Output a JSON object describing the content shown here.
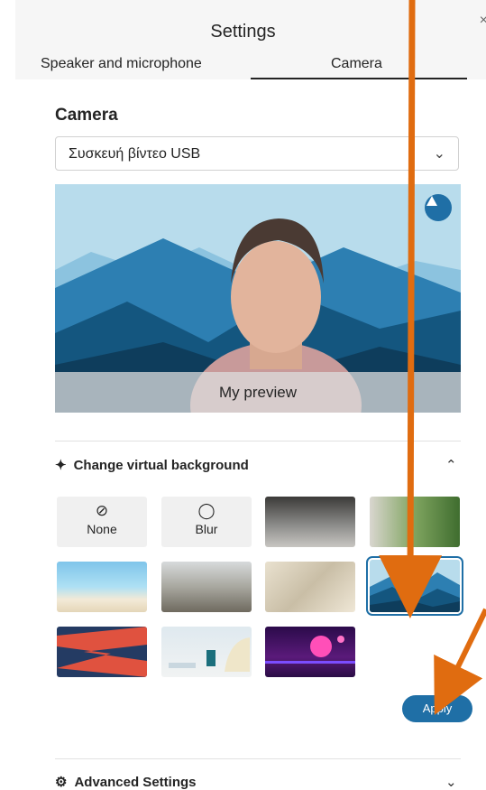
{
  "header": {
    "title": "Settings",
    "close_icon": "close-icon"
  },
  "tabs": [
    {
      "label": "Speaker and microphone",
      "active": false
    },
    {
      "label": "Camera",
      "active": true
    }
  ],
  "camera": {
    "section_title": "Camera",
    "device_value": "Συσκευή βίντεο USB",
    "preview_label": "My preview"
  },
  "virtual_background": {
    "title": "Change virtual background",
    "options": [
      {
        "label": "None",
        "icon": "none-icon"
      },
      {
        "label": "Blur",
        "icon": "blur-icon"
      }
    ],
    "apply_label": "Apply"
  },
  "advanced": {
    "title": "Advanced Settings"
  },
  "colors": {
    "accent": "#1f6fa6",
    "annotation_arrow": "#e06c10"
  }
}
